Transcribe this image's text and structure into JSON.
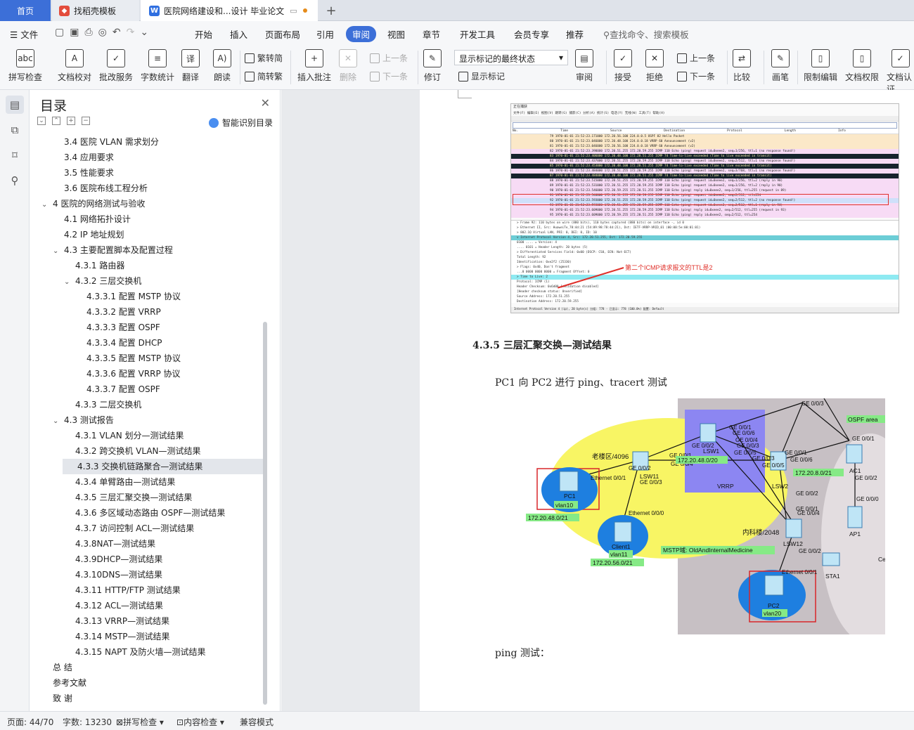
{
  "tabs": {
    "home": "首页",
    "template": "找稻壳模板",
    "document": "医院网络建设和...设计 毕业论文"
  },
  "menu": {
    "file": "文件",
    "items": [
      "开始",
      "插入",
      "页面布局",
      "引用",
      "审阅",
      "视图",
      "章节",
      "开发工具",
      "会员专享",
      "推荐"
    ],
    "active": "审阅",
    "search": "查找命令、搜索模板"
  },
  "ribbon": {
    "spell": "拼写检查",
    "proof": "文档校对",
    "batch": "批改服务",
    "wordcount": "字数统计",
    "translate": "翻译",
    "read": "朗读",
    "trad": "繁转简",
    "simp": "简转繁",
    "insert_comment": "插入批注",
    "delete": "删除",
    "prev": "上一条",
    "next": "下一条",
    "revise": "修订",
    "markup_select": "显示标记的最终状态",
    "show_markup": "显示标记",
    "review": "审阅",
    "accept": "接受",
    "reject": "拒绝",
    "prev2": "上一条",
    "next2": "下一条",
    "compare": "比较",
    "pen": "画笔",
    "restrict": "限制编辑",
    "rights": "文档权限",
    "auth": "文档认证"
  },
  "toc": {
    "title": "目录",
    "smart": "智能识别目录",
    "items": [
      {
        "text": "3.4 医院 VLAN 需求划分",
        "level": 2
      },
      {
        "text": "3.4 应用要求",
        "level": 2
      },
      {
        "text": "3.5 性能要求",
        "level": 2
      },
      {
        "text": "3.6 医院布线工程分析",
        "level": 2
      },
      {
        "text": "4 医院的网络测试与验收",
        "level": 1,
        "caret": true
      },
      {
        "text": "4.1 网络拓扑设计",
        "level": 2
      },
      {
        "text": "4.2 IP 地址规划",
        "level": 2
      },
      {
        "text": "4.3 主要配置脚本及配置过程",
        "level": 2,
        "caret": true
      },
      {
        "text": "4.3.1 路由器",
        "level": 3
      },
      {
        "text": "4.3.2 三层交换机",
        "level": 3,
        "caret": true
      },
      {
        "text": "4.3.3.1 配置 MSTP 协议",
        "level": 4
      },
      {
        "text": "4.3.3.2 配置 VRRP",
        "level": 4
      },
      {
        "text": "4.3.3.3 配置 OSPF",
        "level": 4
      },
      {
        "text": "4.3.3.4 配置 DHCP",
        "level": 4
      },
      {
        "text": "4.3.3.5 配置 MSTP 协议",
        "level": 4
      },
      {
        "text": "4.3.3.6 配置 VRRP 协议",
        "level": 4
      },
      {
        "text": "4.3.3.7 配置 OSPF",
        "level": 4
      },
      {
        "text": "4.3.3 二层交换机",
        "level": 3
      },
      {
        "text": "4.3 测试报告",
        "level": 2,
        "caret": true
      },
      {
        "text": "4.3.1 VLAN 划分—测试结果",
        "level": 3
      },
      {
        "text": "4.3.2 跨交换机 VLAN—测试结果",
        "level": 3
      },
      {
        "text": "4.3.3 交换机链路聚合—测试结果",
        "level": 3,
        "selected": true
      },
      {
        "text": "4.3.4 单臂路由—测试结果",
        "level": 3
      },
      {
        "text": "4.3.5 三层汇聚交换—测试结果",
        "level": 3
      },
      {
        "text": "4.3.6 多区域动态路由 OSPF—测试结果",
        "level": 3
      },
      {
        "text": "4.3.7 访问控制 ACL—测试结果",
        "level": 3
      },
      {
        "text": "4.3.8NAT—测试结果",
        "level": 3
      },
      {
        "text": "4.3.9DHCP—测试结果",
        "level": 3
      },
      {
        "text": "4.3.10DNS—测试结果",
        "level": 3
      },
      {
        "text": "4.3.11 HTTP/FTP 测试结果",
        "level": 3
      },
      {
        "text": "4.3.12 ACL—测试结果",
        "level": 3
      },
      {
        "text": "4.3.13 VRRP—测试结果",
        "level": 3
      },
      {
        "text": "4.3.14 MSTP—测试结果",
        "level": 3
      },
      {
        "text": "4.3.15 NAPT 及防火墙—测试结果",
        "level": 3
      },
      {
        "text": "总    结",
        "level": 1
      },
      {
        "text": "参考文献",
        "level": 1
      },
      {
        "text": "致    谢",
        "level": 1
      }
    ]
  },
  "document": {
    "heading": "4.3.5 三层汇聚交换—测试结果",
    "para1": "PC1 向 PC2 进行 ping、tracert 测试",
    "para2": "ping 测试：",
    "wireshark": {
      "title": "正在捕获",
      "menu": "文件(F)  编辑(E)  视图(V)  跳转(G)  捕获(C)  分析(A)  统计(S)  电话(Y)  无线(W)  工具(T)  帮助(H)",
      "columns": [
        "No.",
        "Time",
        "Source",
        "Destination",
        "Protocol",
        "Length",
        "Info"
      ],
      "rows": [
        {
          "t": "79 1970-01-01 21:52:23.171000   172.20.56.100    224.0.0.5       OSPF    82 Hello Packet",
          "c": "ospf"
        },
        {
          "t": "80 1970-01-01 21:52:23.046000   172.20.48.100    224.0.0.18      VRRP    60 Announcement (v2)",
          "c": "ospf"
        },
        {
          "t": "81 1970-01-01 21:52:23.046000   172.20.56.100    224.0.0.18      VRRP    60 Announcement (v2)",
          "c": "ospf"
        },
        {
          "t": "82 1970-01-01 21:52:23.390000   172.20.51.255    172.20.59.255   ICMP   110 Echo (ping) request  id=0xeee2, seq=1/256, ttl=1 (no response found!)",
          "c": "pink"
        },
        {
          "t": "83 1970-01-01 21:52:23.406000   172.20.48.100    172.20.51.255   ICMP    74 Time-to-live exceeded (Time to live exceeded in transit)",
          "c": "dark"
        },
        {
          "t": "84 1970-01-01 21:52:23.437000   172.20.51.255    172.20.59.255   ICMP   110 Echo (ping) request  id=0xeee2, seq=2/512, ttl=1 (no response found!)",
          "c": "pink"
        },
        {
          "t": "85 1970-01-01 21:52:23.453000   172.20.48.100    172.20.51.255   ICMP    74 Time-to-live exceeded (Time to live exceeded in transit)",
          "c": "dark"
        },
        {
          "t": "86 1970-01-01 21:52:23.484000   172.20.51.255    172.20.59.255   ICMP   110 Echo (ping) request  id=0xeee2, seq=3/768, ttl=1 (no response found!)",
          "c": "pink"
        },
        {
          "t": "87 1970-01-01 21:52:23.484000   172.20.48.100    172.20.51.255   ICMP    74 Time-to-live exceeded (Time to live exceeded in transit)",
          "c": "dark"
        },
        {
          "t": "88 1970-01-01 21:52:23.515000   172.20.51.255    172.20.59.255   ICMP   110 Echo (ping) request  id=0xeee2, seq=1/256, ttl=2 (reply in 90)",
          "c": "pink"
        },
        {
          "t": "89 1970-01-01 21:52:23.531000   172.20.51.255    172.20.59.255   ICMP   110 Echo (ping) request  id=0xeee2, seq=1/256, ttl=2 (reply in 90)",
          "c": "pink"
        },
        {
          "t": "90 1970-01-01 21:52:23.546000   172.20.59.255    172.20.51.255   ICMP   110 Echo (ping) reply    id=0xeee2, seq=1/256, ttl=255 (request in 89)",
          "c": "pink"
        },
        {
          "t": "91 1970-01-01 21:52:23.546000   172.20.51.255    172.20.59.255   ICMP   110 Echo (ping) request  id=0xeee2, seq=2/512, ttl=254",
          "c": "pink"
        },
        {
          "t": "92 1970-01-01 21:52:23.593000   172.20.51.255    172.20.59.255   ICMP   110 Echo (ping) request  id=0xeee2, seq=2/512, ttl=2 (no response found!)",
          "c": "sel"
        },
        {
          "t": "93 1970-01-01 21:52:23.593000   172.20.51.255    172.20.59.255   ICMP   110 Echo (ping) request  id=0xeee2, seq=2/512, ttl=1 (reply in 94)",
          "c": "pink"
        },
        {
          "t": "94 1970-01-01 21:52:23.609000   172.20.51.255    172.20.59.255   ICMP   110 Echo (ping) reply    id=0xeee2, seq=2/512, ttl=255 (request in 93)",
          "c": "pink"
        },
        {
          "t": "95 1970-01-01 21:52:23.609000   172.20.59.255    172.20.51.255   ICMP   110 Echo (ping) reply    id=0xeee2, seq=2/512, ttl=254",
          "c": "pink"
        }
      ],
      "details": [
        {
          "t": "> Frame 92: 110 bytes on wire (880 bits), 110 bytes captured (880 bits) on interface -, id 0",
          "c": ""
        },
        {
          "t": "> Ethernet II, Src: HuaweiTe_78:4d:21 (54:89:98:78:4d:21), Dst: IETF-VRRP-VRID_01 (00:00:5e:00:01:01)",
          "c": ""
        },
        {
          "t": "> 802.1Q Virtual LAN, PRI: 0, DEI: 0, ID: 10",
          "c": ""
        },
        {
          "t": "v Internet Protocol Version 4, Src: 172.20.51.255, Dst: 172.20.59.255",
          "c": "ip"
        },
        {
          "t": "    0100 .... = Version: 4",
          "c": ""
        },
        {
          "t": "    .... 0101 = Header Length: 20 bytes (5)",
          "c": ""
        },
        {
          "t": "  > Differentiated Services Field: 0x00 (DSCP: CS0, ECN: Not-ECT)",
          "c": ""
        },
        {
          "t": "    Total Length: 92",
          "c": ""
        },
        {
          "t": "    Identification: 0xe2f2 (25330)",
          "c": ""
        },
        {
          "t": "  > Flags: 0x40, Don't fragment",
          "c": ""
        },
        {
          "t": "    ...0 0000 0000 0000 = Fragment Offset: 0",
          "c": ""
        },
        {
          "t": "  > Time to Live: 2",
          "c": "ttl"
        },
        {
          "t": "    Protocol: ICMP (1)",
          "c": ""
        },
        {
          "t": "    Header Checksum: 0x6d00 [validation disabled]",
          "c": ""
        },
        {
          "t": "    [Header checksum status: Unverified]",
          "c": ""
        },
        {
          "t": "    Source Address: 172.20.51.255",
          "c": ""
        },
        {
          "t": "    Destination Address: 172.20.59.255",
          "c": ""
        }
      ],
      "annotation": "第二个ICMP请求报文的TTL是2",
      "status": "Internet Protocol Version 4 (ip), 20 byte(s)        分组: 778 · 已显示: 778 (100.0%)        配置: Default"
    },
    "topology": {
      "labels": {
        "old_building": "老楼区/4096",
        "inpatient": "内科楼/2048",
        "ip_48": "172.20.48.0/20",
        "ip_8": "172.20.8.0/21",
        "ip_pc1": "172.20.48.0/21",
        "ip_client": "172.20.56.0/21",
        "mstp": "MSTP域: OldAndInternalMedicine",
        "vrrp": "VRRP",
        "ospf": "OSPF area",
        "pc1": "PC1",
        "vlan10": "vlan10",
        "client1": "Client1",
        "vlan11": "vlan11",
        "pc2": "PC2",
        "vlan20": "vlan20",
        "lsw1": "LSW1",
        "lsw11": "LSW11",
        "lsw2": "LSW2",
        "lsw12": "LSW12",
        "ac1": "AC1",
        "ap1": "AP1",
        "sta1": "STA1",
        "ce": "Ce"
      }
    }
  },
  "status": {
    "page": "页面: 44/70",
    "words": "字数: 13230",
    "spell": "拼写检查",
    "content": "内容检查",
    "compat": "兼容模式"
  }
}
